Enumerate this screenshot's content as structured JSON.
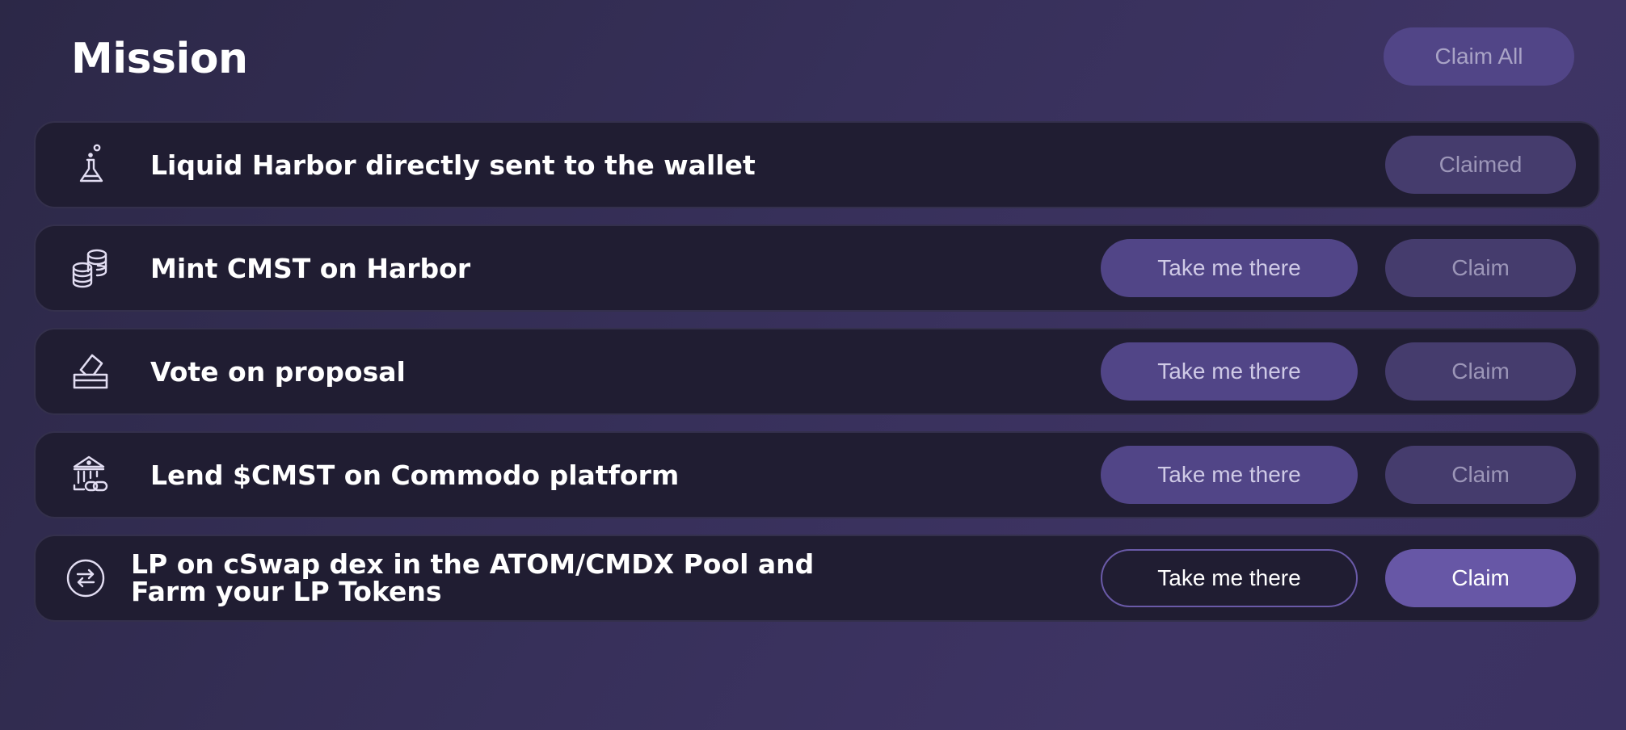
{
  "header": {
    "title": "Mission",
    "claim_all_label": "Claim All"
  },
  "missions": [
    {
      "icon": "flask-icon",
      "label": "Liquid Harbor directly sent to the wallet",
      "claim_label": "Claimed"
    },
    {
      "icon": "coins-icon",
      "label": "Mint CMST on Harbor",
      "take_label": "Take me there",
      "claim_label": "Claim"
    },
    {
      "icon": "vote-box-icon",
      "label": "Vote on proposal",
      "take_label": "Take me there",
      "claim_label": "Claim"
    },
    {
      "icon": "bank-link-icon",
      "label": "Lend $CMST on Commodo platform",
      "take_label": "Take me there",
      "claim_label": "Claim"
    },
    {
      "icon": "swap-icon",
      "label": "LP on cSwap dex in the ATOM/CMDX Pool and Farm your LP Tokens",
      "take_label": "Take me there",
      "claim_label": "Claim"
    }
  ],
  "colors": {
    "card_bg": "#201d32",
    "button_purple": "#514587",
    "button_disabled": "#453c6d",
    "button_active": "#6757a6",
    "icon_stroke": "#e2ddf2"
  }
}
